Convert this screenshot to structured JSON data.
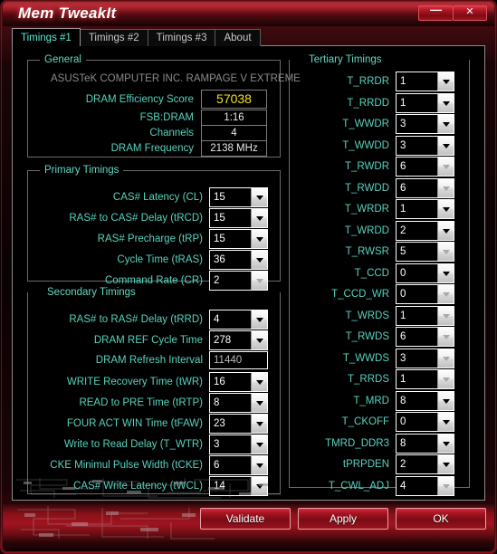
{
  "window": {
    "title": "Mem TweakIt",
    "minimize_label": "—",
    "close_label": "✕"
  },
  "tabs": [
    {
      "label": "Timings #1",
      "active": true
    },
    {
      "label": "Timings #2",
      "active": false
    },
    {
      "label": "Timings #3",
      "active": false
    },
    {
      "label": "About",
      "active": false
    }
  ],
  "general": {
    "title": "General",
    "motherboard": "ASUSTeK COMPUTER INC. RAMPAGE V EXTREME",
    "rows": [
      {
        "label": "DRAM Efficiency Score",
        "value": "57038",
        "style": "score"
      },
      {
        "label": "FSB:DRAM",
        "value": "1:16",
        "style": "plain"
      },
      {
        "label": "Channels",
        "value": "4",
        "style": "plain"
      },
      {
        "label": "DRAM Frequency",
        "value": "2138 MHz",
        "style": "plain"
      }
    ]
  },
  "primary": {
    "title": "Primary Timings",
    "rows": [
      {
        "label": "CAS# Latency (CL)",
        "value": "15",
        "disabled": false
      },
      {
        "label": "RAS# to CAS# Delay (tRCD)",
        "value": "15",
        "disabled": false
      },
      {
        "label": "RAS# Precharge (tRP)",
        "value": "15",
        "disabled": false
      },
      {
        "label": "Cycle Time (tRAS)",
        "value": "36",
        "disabled": false
      },
      {
        "label": "Command Rate (CR)",
        "value": "2",
        "disabled": true
      }
    ]
  },
  "secondary": {
    "title": "Secondary Timings",
    "rows": [
      {
        "label": "RAS# to RAS# Delay (tRRD)",
        "value": "4",
        "type": "combo",
        "disabled": false
      },
      {
        "label": "DRAM REF Cycle Time",
        "value": "278",
        "type": "combo",
        "disabled": false
      },
      {
        "label": "DRAM Refresh Interval",
        "value": "11440",
        "type": "text",
        "disabled": false
      },
      {
        "label": "WRITE Recovery Time (tWR)",
        "value": "16",
        "type": "combo",
        "disabled": false
      },
      {
        "label": "READ to PRE Time (tRTP)",
        "value": "8",
        "type": "combo",
        "disabled": false
      },
      {
        "label": "FOUR ACT WIN Time (tFAW)",
        "value": "23",
        "type": "combo",
        "disabled": false
      },
      {
        "label": "Write to Read Delay (T_WTR)",
        "value": "3",
        "type": "combo",
        "disabled": false
      },
      {
        "label": "CKE Minimul Pulse Width (tCKE)",
        "value": "6",
        "type": "combo",
        "disabled": false
      },
      {
        "label": "CAS# Write Latency (tWCL)",
        "value": "14",
        "type": "combo",
        "disabled": false
      }
    ]
  },
  "tertiary": {
    "title": "Tertiary Timings",
    "rows": [
      {
        "label": "T_RRDR",
        "value": "1",
        "disabled": false
      },
      {
        "label": "T_RRDD",
        "value": "1",
        "disabled": false
      },
      {
        "label": "T_WWDR",
        "value": "3",
        "disabled": false
      },
      {
        "label": "T_WWDD",
        "value": "3",
        "disabled": false
      },
      {
        "label": "T_RWDR",
        "value": "6",
        "disabled": true
      },
      {
        "label": "T_RWDD",
        "value": "6",
        "disabled": true
      },
      {
        "label": "T_WRDR",
        "value": "1",
        "disabled": false
      },
      {
        "label": "T_WRDD",
        "value": "2",
        "disabled": false
      },
      {
        "label": "T_RWSR",
        "value": "5",
        "disabled": true
      },
      {
        "label": "T_CCD",
        "value": "0",
        "disabled": false
      },
      {
        "label": "T_CCD_WR",
        "value": "0",
        "disabled": true
      },
      {
        "label": "T_WRDS",
        "value": "1",
        "disabled": true
      },
      {
        "label": "T_RWDS",
        "value": "6",
        "disabled": true
      },
      {
        "label": "T_WWDS",
        "value": "3",
        "disabled": true
      },
      {
        "label": "T_RRDS",
        "value": "1",
        "disabled": true
      },
      {
        "label": "T_MRD",
        "value": "8",
        "disabled": false
      },
      {
        "label": "T_CKOFF",
        "value": "0",
        "disabled": false
      },
      {
        "label": "TMRD_DDR3",
        "value": "8",
        "disabled": false
      },
      {
        "label": "tPRPDEN",
        "value": "2",
        "disabled": false
      },
      {
        "label": "T_CWL_ADJ",
        "value": "4",
        "disabled": true
      }
    ]
  },
  "buttons": [
    {
      "label": "Validate"
    },
    {
      "label": "Apply"
    },
    {
      "label": "OK"
    }
  ],
  "colors": {
    "accent_red": "#a01420",
    "label_cyan": "#56d3bf",
    "score_yellow": "#f2e11c",
    "panel_black": "#000000"
  }
}
